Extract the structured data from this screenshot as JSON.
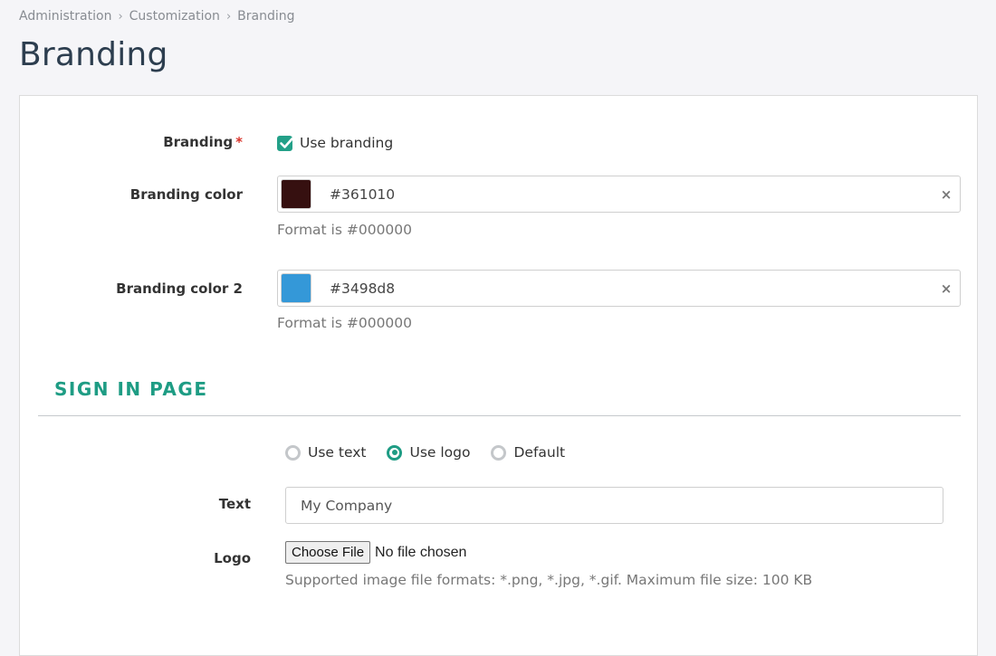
{
  "breadcrumb": {
    "items": [
      "Administration",
      "Customization",
      "Branding"
    ],
    "separator": ">"
  },
  "page_title": "Branding",
  "form": {
    "branding": {
      "label": "Branding",
      "required_mark": "*",
      "checkbox_label": "Use branding",
      "checked": true
    },
    "branding_color": {
      "label": "Branding color",
      "value": "#361010",
      "swatch": "#361010",
      "hint": "Format is #000000",
      "clear_icon": "×"
    },
    "branding_color_2": {
      "label": "Branding color 2",
      "value": "#3498d8",
      "swatch": "#3498d8",
      "hint": "Format is #000000",
      "clear_icon": "×"
    }
  },
  "sign_in_page": {
    "title": "SIGN IN PAGE",
    "mode_options": [
      {
        "label": "Use text",
        "checked": false
      },
      {
        "label": "Use logo",
        "checked": true
      },
      {
        "label": "Default",
        "checked": false
      }
    ],
    "text": {
      "label": "Text",
      "value": "My Company"
    },
    "logo": {
      "label": "Logo",
      "button_label": "Choose File",
      "status": "No file chosen",
      "hint": "Supported image file formats: *.png, *.jpg, *.gif. Maximum file size: 100 KB"
    }
  },
  "colors": {
    "accent": "#1e9c84",
    "title": "#2d3e4f",
    "required": "#d9342b"
  }
}
